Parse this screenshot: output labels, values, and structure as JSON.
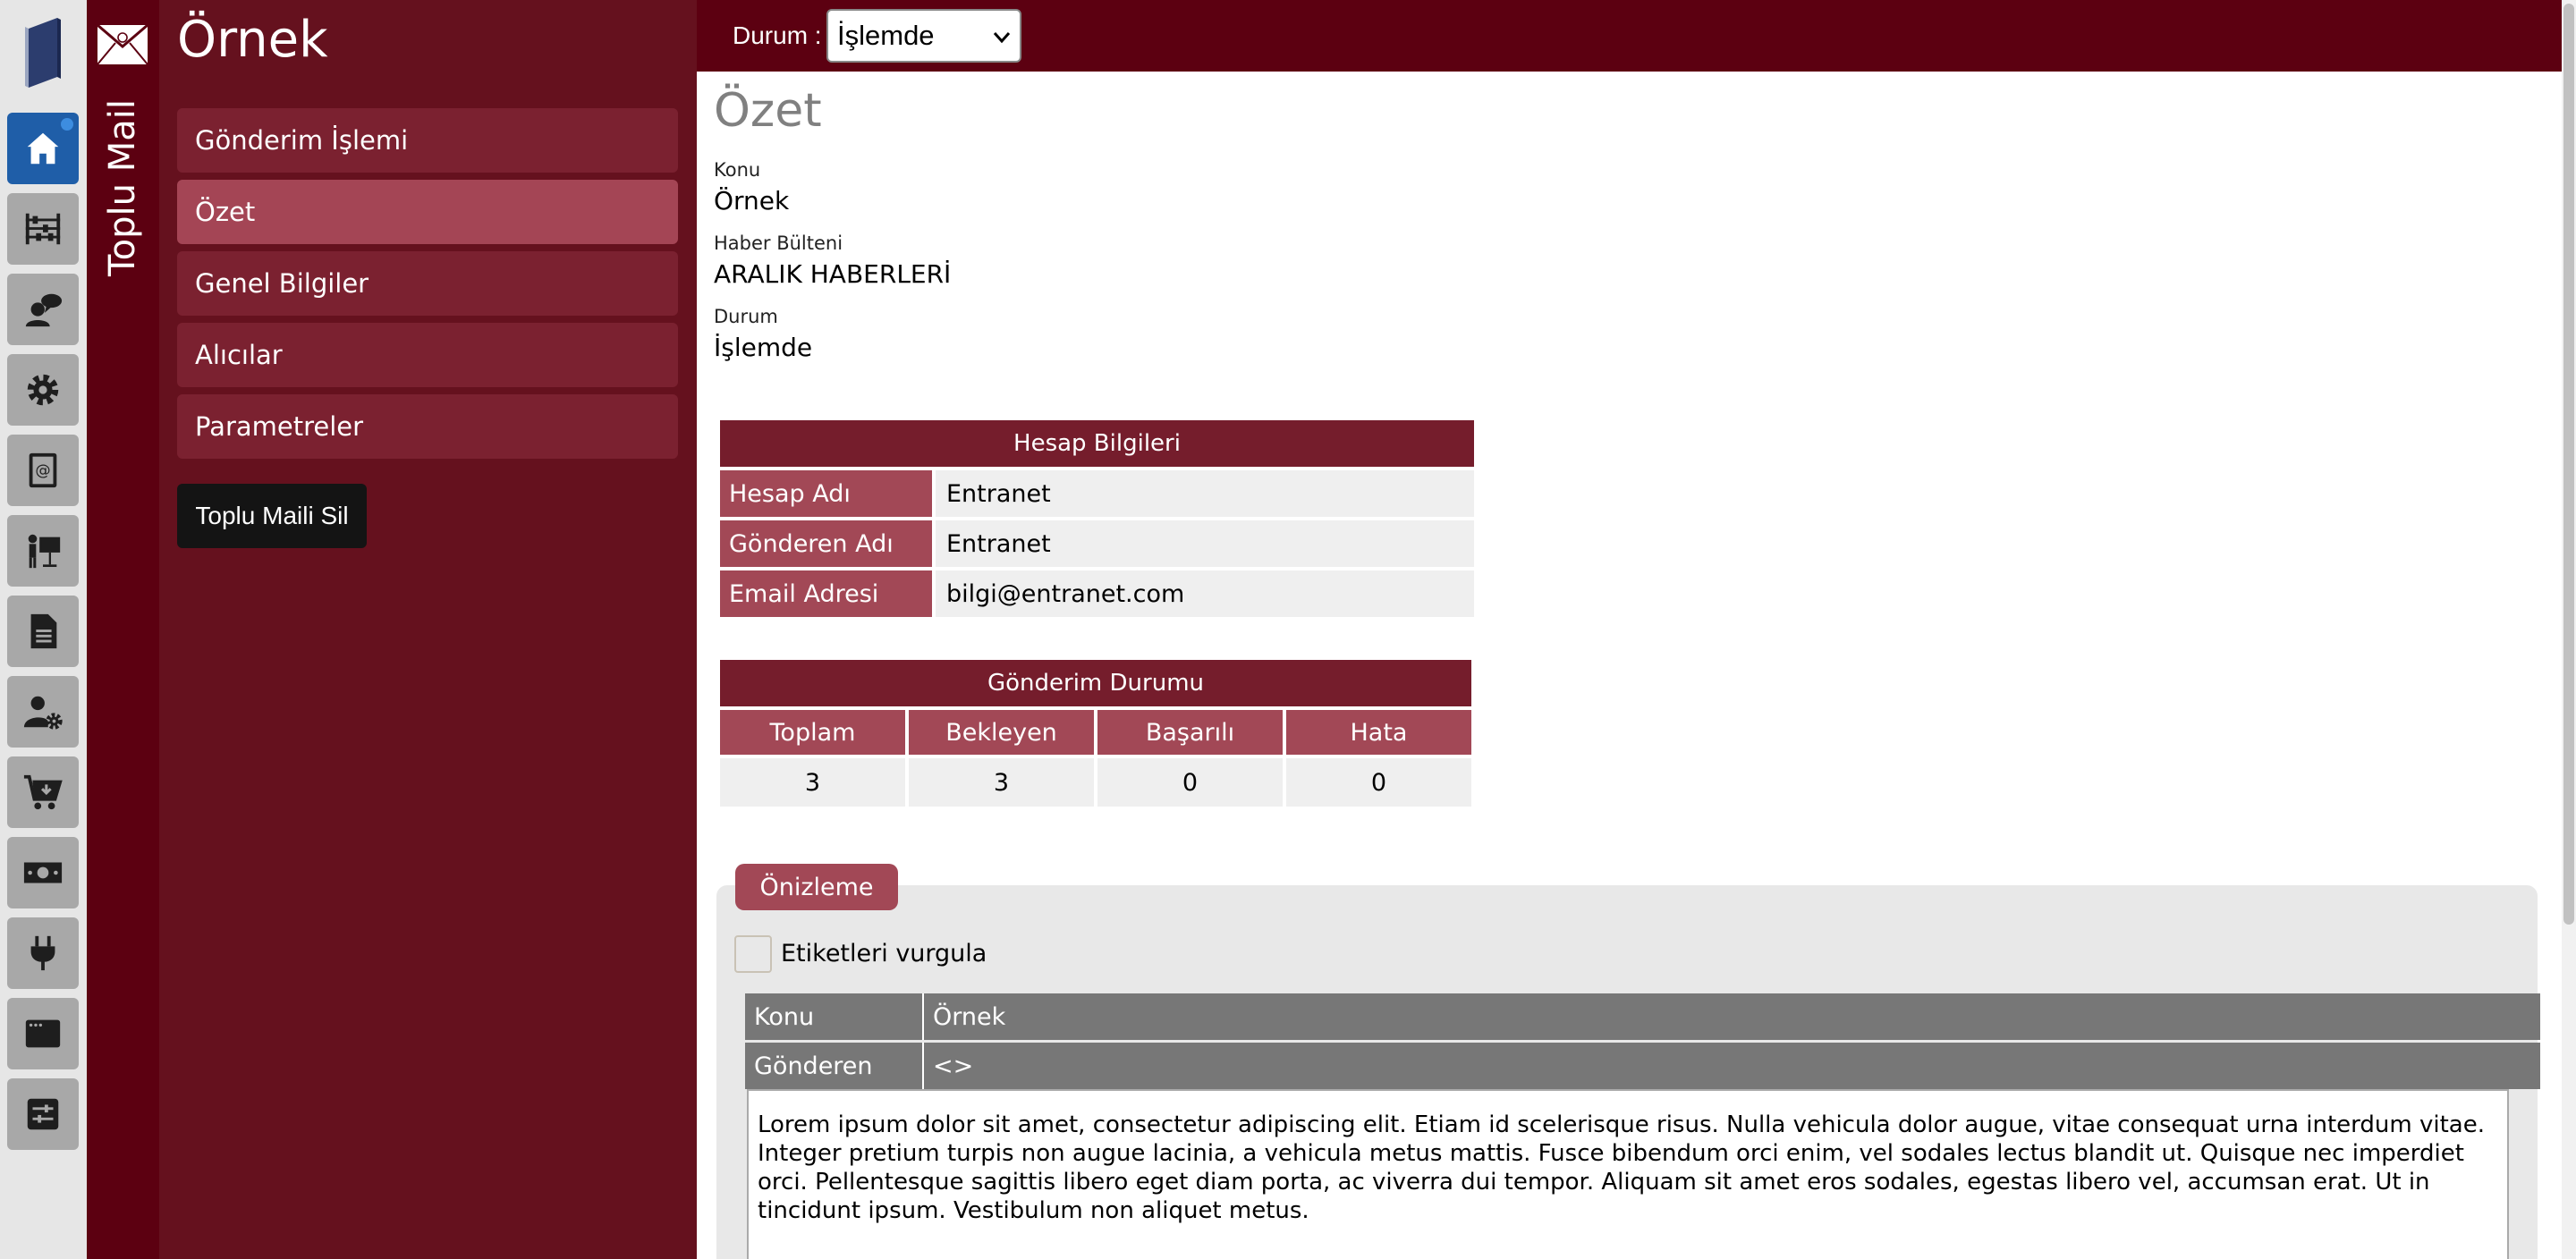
{
  "app": {
    "module_title": "Toplu Mail",
    "record_title": "Örnek",
    "brand_color": "#5c0011"
  },
  "rail": {
    "items": [
      {
        "name": "home",
        "icon": "home-icon",
        "active": true
      },
      {
        "name": "abacus",
        "icon": "abacus-icon",
        "active": false
      },
      {
        "name": "chat-user",
        "icon": "user-chat-icon",
        "active": false
      },
      {
        "name": "settings",
        "icon": "gear-icon",
        "active": false
      },
      {
        "name": "address-book",
        "icon": "address-book-icon",
        "active": false
      },
      {
        "name": "presentation",
        "icon": "presenter-icon",
        "active": false
      },
      {
        "name": "document",
        "icon": "document-icon",
        "active": false
      },
      {
        "name": "user-settings",
        "icon": "user-gear-icon",
        "active": false
      },
      {
        "name": "cart",
        "icon": "cart-icon",
        "active": false
      },
      {
        "name": "money",
        "icon": "money-icon",
        "active": false
      },
      {
        "name": "plugin",
        "icon": "plug-icon",
        "active": false
      },
      {
        "name": "window",
        "icon": "window-icon",
        "active": false
      },
      {
        "name": "sliders",
        "icon": "sliders-icon",
        "active": false
      }
    ]
  },
  "menu": {
    "items": [
      {
        "label": "Gönderim İşlemi",
        "active": false
      },
      {
        "label": "Özet",
        "active": true
      },
      {
        "label": "Genel Bilgiler",
        "active": false
      },
      {
        "label": "Alıcılar",
        "active": false
      },
      {
        "label": "Parametreler",
        "active": false
      }
    ],
    "delete_label": "Toplu Maili Sil"
  },
  "topbar": {
    "status_label": "Durum :",
    "status_value": "İşlemde"
  },
  "summary": {
    "title": "Özet",
    "fields": [
      {
        "label": "Konu",
        "value": "Örnek"
      },
      {
        "label": "Haber Bülteni",
        "value": "ARALIK HABERLERİ"
      },
      {
        "label": "Durum",
        "value": "İşlemde"
      }
    ]
  },
  "account": {
    "title": "Hesap Bilgileri",
    "rows": [
      {
        "key": "Hesap Adı",
        "value": "Entranet"
      },
      {
        "key": "Gönderen Adı",
        "value": "Entranet"
      },
      {
        "key": "Email Adresi",
        "value": "bilgi@entranet.com"
      }
    ]
  },
  "sending": {
    "title": "Gönderim Durumu",
    "columns": [
      "Toplam",
      "Bekleyen",
      "Başarılı",
      "Hata"
    ],
    "values": [
      "3",
      "3",
      "0",
      "0"
    ]
  },
  "preview": {
    "tab_label": "Önizleme",
    "highlight_label": "Etiketleri vurgula",
    "subject_key": "Konu",
    "subject_value": "Örnek",
    "sender_key": "Gönderen",
    "sender_value": "<>",
    "body": "Lorem ipsum dolor sit amet, consectetur adipiscing elit. Etiam id scelerisque risus. Nulla vehicula dolor augue, vitae consequat urna interdum vitae. Integer pretium turpis non augue lacinia, a vehicula metus mattis. Fusce bibendum orci enim, vel sodales lectus blandit ut. Quisque nec imperdiet orci. Pellentesque sagittis libero eget diam porta, ac viverra dui tempor. Aliquam sit amet eros sodales, egestas libero vel, accumsan erat. Ut in tincidunt ipsum. Vestibulum non aliquet metus."
  }
}
